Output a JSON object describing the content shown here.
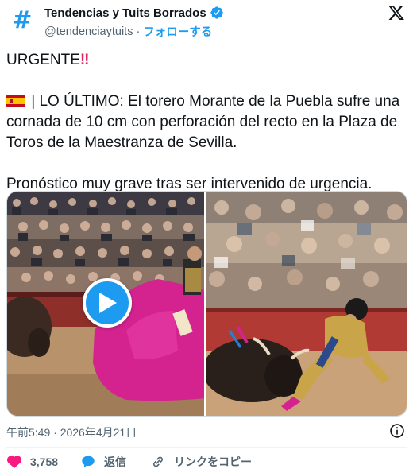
{
  "header": {
    "avatar_symbol": "#",
    "display_name": "Tendencias y Tuits Borrados",
    "handle": "@tendenciaytuits",
    "separator": "·",
    "follow_label": "フォローする"
  },
  "tweet": {
    "line1": "URGENTE",
    "line1_emoji": "‼",
    "line2": " | LO ÚLTIMO: El torero Morante de la Puebla sufre una cornada de 10 cm con perforación del recto en la Plaza de Toros de la Maestranza de Sevilla.",
    "line3": "Pronóstico muy grave tras ser intervenido de urgencia."
  },
  "footer": {
    "timestamp": "午前5:49 · 2026年4月21日",
    "like_count": "3,758",
    "reply_label": "返信",
    "copy_link_label": "リンクをコピー"
  },
  "colors": {
    "accent": "#1d9bf0",
    "like": "#f91880",
    "muted": "#536471",
    "text": "#0f1419"
  },
  "icons": {
    "verified": "verified-badge-icon",
    "logo": "x-logo-icon",
    "play": "play-icon",
    "info": "info-icon",
    "like": "heart-icon",
    "reply": "speech-bubble-icon",
    "link": "link-icon",
    "flag": "spain-flag-icon"
  }
}
